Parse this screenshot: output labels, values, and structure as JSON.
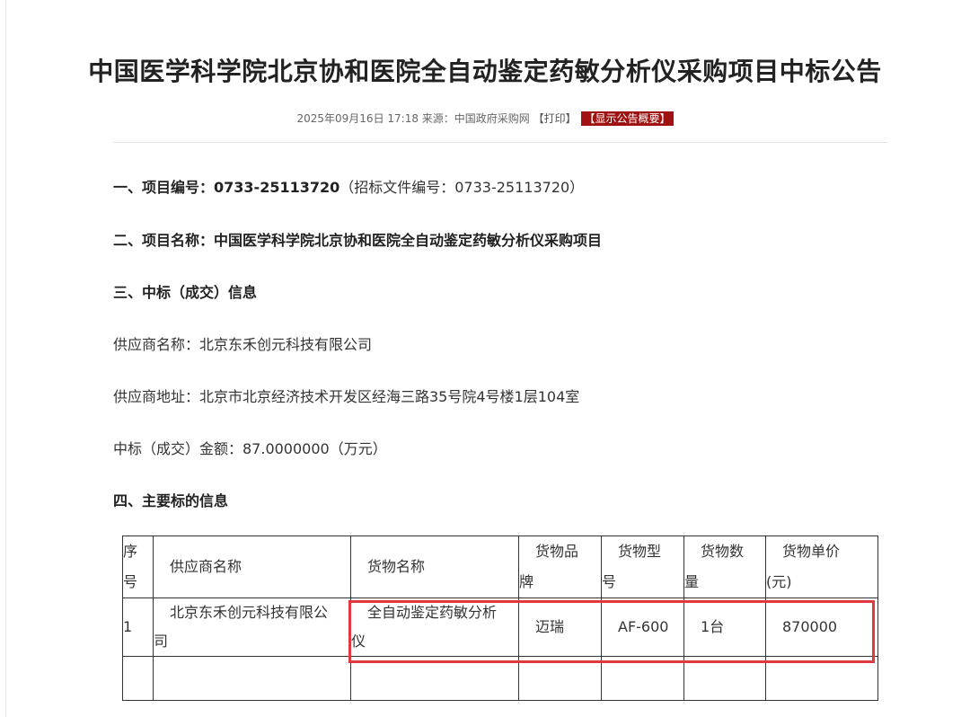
{
  "article": {
    "title": "中国医学科学院北京协和医院全自动鉴定药敏分析仪采购项目中标公告",
    "meta": {
      "datetime": "2025年09月16日 17:18",
      "source": "来源：中国政府采购网",
      "print": "【打印】",
      "summary": "【显示公告概要】"
    }
  },
  "sections": {
    "s1_label": "一、项目编号：",
    "s1_value": "0733-25113720",
    "s1_note": "（招标文件编号：0733-25113720）",
    "s2_label": "二、项目名称：",
    "s2_value": "中国医学科学院北京协和医院全自动鉴定药敏分析仪采购项目",
    "s3_heading": "三、中标（成交）信息",
    "supplier_name": "供应商名称：北京东禾创元科技有限公司",
    "supplier_address": "供应商地址：北京市北京经济技术开发区经海三路35号院4号楼1层104室",
    "award_amount": "中标（成交）金额：87.0000000（万元）",
    "s4_heading": "四、主要标的信息"
  },
  "table": {
    "headers": {
      "seq_1": "序",
      "seq_2": "号",
      "supplier": "供应商名称",
      "goods": "货物名称",
      "brand_1": "货物品",
      "brand_2": "牌",
      "model_1": "货物型",
      "model_2": "号",
      "qty_1": "货物数",
      "qty_2": "量",
      "price_1": "货物单价",
      "price_2": "(元)"
    },
    "row": {
      "seq": "1",
      "supplier_1": "北京东禾创元科技有限公",
      "supplier_2": "司",
      "goods_1": "全自动鉴定药敏分析",
      "goods_2": "仪",
      "brand": "迈瑞",
      "model": "AF-600",
      "qty": "1台",
      "price": "870000"
    }
  },
  "colors": {
    "highlight_border": "#e0393f",
    "summary_button_bg": "#a01212"
  }
}
